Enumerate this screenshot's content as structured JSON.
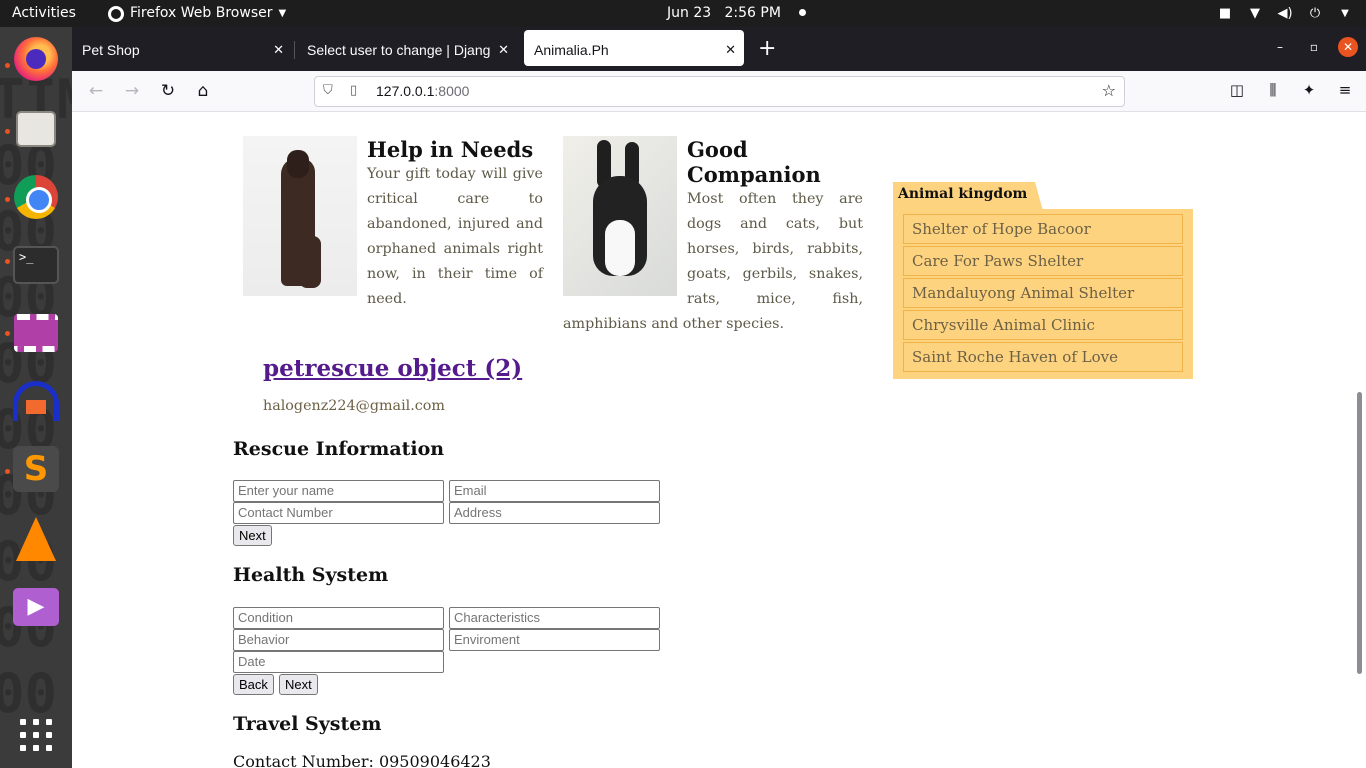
{
  "system": {
    "activities": "Activities",
    "app_name": "Firefox Web Browser",
    "date": "Jun 23",
    "time": "2:56 PM"
  },
  "browser": {
    "tabs": [
      {
        "label": "Pet Shop"
      },
      {
        "label": "Select user to change | Djang"
      },
      {
        "label": "Animalia.Ph"
      }
    ],
    "url_host": "127.0.0.1",
    "url_port": ":8000"
  },
  "page": {
    "features": [
      {
        "title": "Help in Needs",
        "text": "Your gift today will give critical care to abandoned, injured and orphaned animals right now, in their time of need.",
        "image": "dog-photo"
      },
      {
        "title": "Good Companion",
        "text": "Most often they are dogs and cats, but horses, birds, rabbits, goats, gerbils, snakes, rats, mice, fish, amphibians and other species.",
        "image": "rabbit-photo"
      }
    ],
    "sidebar": {
      "title": "Animal kingdom",
      "links": [
        "Shelter of Hope Bacoor",
        "Care For Paws Shelter",
        "Mandaluyong Animal Shelter",
        "Chrysville Animal Clinic",
        "Saint Roche Haven of Love"
      ]
    },
    "post": {
      "title": "petrescue object (2)",
      "email": "halogenz224@gmail.com"
    },
    "rescue": {
      "title": "Rescue Information",
      "name_placeholder": "Enter your name",
      "email_placeholder": "Email",
      "contact_placeholder": "Contact Number",
      "address_placeholder": "Address",
      "next_label": "Next"
    },
    "health": {
      "title": "Health System",
      "condition_placeholder": "Condition",
      "characteristics_placeholder": "Characteristics",
      "behavior_placeholder": "Behavior",
      "environment_placeholder": "Enviroment",
      "date_placeholder": "Date",
      "back_label": "Back",
      "next_label": "Next"
    },
    "travel": {
      "title": "Travel System",
      "contact_line": "Contact Number: 09509046423"
    }
  }
}
